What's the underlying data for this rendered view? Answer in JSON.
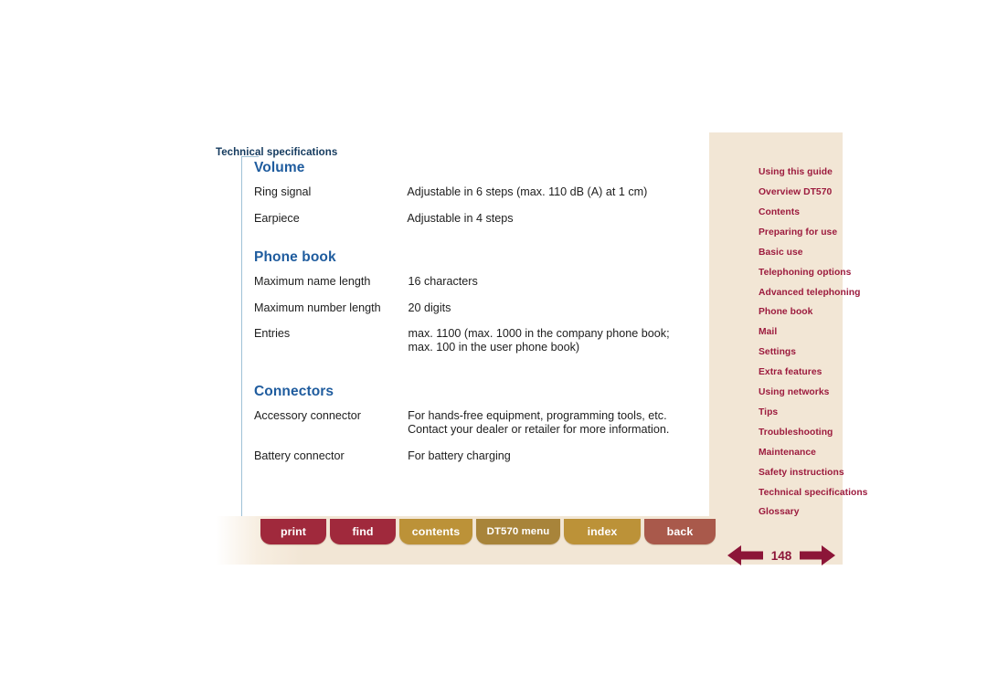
{
  "header": {
    "running_title": "Technical specifications"
  },
  "sections": [
    {
      "title": "Volume",
      "rows": [
        {
          "term": "Ring signal",
          "value": "Adjustable in 6 steps (max. 110 dB (A) at 1 cm)",
          "value2": ""
        },
        {
          "term": "Earpiece",
          "value": "Adjustable in 4 steps",
          "value2": ""
        }
      ]
    },
    {
      "title": "Phone book",
      "rows": [
        {
          "term": "Maximum name length",
          "value": "16 characters",
          "value2": ""
        },
        {
          "term": "Maximum number length",
          "value": "20 digits",
          "value2": ""
        },
        {
          "term": "Entries",
          "value": "max. 1100 (max. 1000 in the company phone book;",
          "value2": "max. 100 in the user phone book)"
        }
      ]
    },
    {
      "title": "Connectors",
      "rows": [
        {
          "term": "Accessory connector",
          "value": "For hands-free equipment, programming tools, etc.",
          "value2": "Contact your dealer or retailer for more information."
        },
        {
          "term": "Battery connector",
          "value": "For battery charging",
          "value2": ""
        }
      ]
    }
  ],
  "sidebar": {
    "items": [
      {
        "label": "Using this guide"
      },
      {
        "label": "Overview DT570"
      },
      {
        "label": "Contents"
      },
      {
        "label": "Preparing for use"
      },
      {
        "label": "Basic use"
      },
      {
        "label": "Telephoning options"
      },
      {
        "label": "Advanced telephoning"
      },
      {
        "label": "Phone book"
      },
      {
        "label": "Mail"
      },
      {
        "label": "Settings"
      },
      {
        "label": "Extra features"
      },
      {
        "label": "Using networks"
      },
      {
        "label": "Tips"
      },
      {
        "label": "Troubleshooting"
      },
      {
        "label": "Maintenance"
      },
      {
        "label": "Safety instructions"
      },
      {
        "label": "Technical specifications"
      },
      {
        "label": "Glossary"
      }
    ]
  },
  "footer": {
    "tabs": [
      {
        "label": "print"
      },
      {
        "label": "find"
      },
      {
        "label": "contents"
      },
      {
        "label": "DT570 menu"
      },
      {
        "label": "index"
      },
      {
        "label": "back"
      }
    ],
    "page_number": "148",
    "prev_icon": "left-arrow-icon",
    "next_icon": "right-arrow-icon"
  },
  "colors": {
    "heading_blue": "#1f5c9e",
    "running_header_navy": "#143a5e",
    "nav_link_red": "#9c1b3e",
    "sidebar_beige": "#f2e6d5",
    "tab_red": "#a0293c",
    "tab_gold": "#bc9238",
    "tab_gold_dark": "#a8843a",
    "tab_back_brown": "#a9594b",
    "arrow_red": "#8c1538",
    "rule_blue": "#9fc1d6"
  }
}
